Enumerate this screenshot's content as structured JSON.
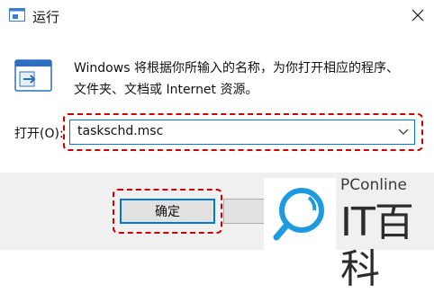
{
  "window": {
    "title": "运行",
    "close_glyph": "✕"
  },
  "body": {
    "description_line1": "Windows 将根据你所输入的名称，为你打开相应的程序、",
    "description_line2": "文件夹、文档或 Internet 资源。"
  },
  "open": {
    "label": "打开(O):",
    "value": "taskschd.msc"
  },
  "buttons": {
    "ok_label": "确定"
  },
  "watermark": {
    "brand": "PConline",
    "name": "IT百科"
  },
  "colors": {
    "accent": "#0078d7",
    "highlight": "#d00000",
    "brand_blue": "#1e9be0"
  }
}
